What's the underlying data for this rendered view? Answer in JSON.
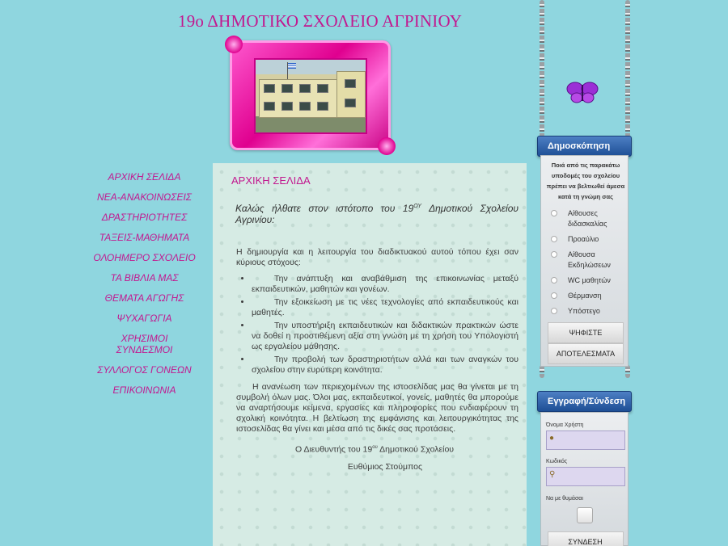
{
  "site": {
    "title": "19ο ΔΗΜΟΤΙΚΟ ΣΧΟΛΕΙΟ ΑΓΡΙΝΙΟΥ"
  },
  "nav": {
    "items": [
      "ΑΡΧΙΚΗ ΣΕΛΙΔΑ",
      "ΝΕΑ-ΑΝΑΚΟΙΝΩΣΕΙΣ",
      "ΔΡΑΣΤΗΡΙΟΤΗΤΕΣ",
      "ΤΑΞΕΙΣ-ΜΑΘΗΜΑΤΑ",
      "ΟΛΟΗΜΕΡΟ ΣΧΟΛΕΙΟ",
      "ΤΑ ΒΙΒΛΙΑ ΜΑΣ",
      "ΘΕΜΑΤΑ ΑΓΩΓΗΣ",
      "ΨΥΧΑΓΩΓΙΑ",
      "ΧΡΗΣΙΜΟΙ ΣΥΝΔΕΣΜΟΙ",
      "ΣΥΛΛΟΓΟΣ ΓΟΝΕΩΝ",
      "ΕΠΙΚΟΙΝΩΝΙΑ"
    ]
  },
  "content": {
    "heading": "ΑΡΧΙΚΗ ΣΕΛΙΔΑ",
    "welcome_pre": "Καλώς ήλθατε στον ιστότοπο του 19",
    "welcome_sup": "ΟΥ",
    "welcome_post": " Δημοτικού Σχολείου Αγρινίου:",
    "intro": "Η δημιουργία και η λειτουργία του διαδικτυακού αυτού τόπου έχει σαν κύριους στόχους:",
    "goals": [
      "Την ανάπτυξη και αναβάθμιση της επικοινωνίας μεταξύ εκπαιδευτικών, μαθητών και γονέων.",
      "Την εξοικείωση με τις νέες τεχνολογίες από εκπαιδευτικούς και μαθητές.",
      "Την υποστήριξη εκπαιδευτικών και διδακτικών πρακτικών ώστε να δοθεί η προστιθέμενη αξία στη γνώση με τη χρήση του Υπολογιστή ως εργαλείου μάθησης.",
      "Την προβολή των δραστηριοτήτων αλλά και των αναγκών του σχολείου στην ευρύτερη κοινότητα."
    ],
    "outro": "Η ανανέωση των περιεχομένων της ιστοσελίδας μας θα γίνεται με τη συμβολή όλων μας. Όλοι μας, εκπαιδευτικοί, γονείς, μαθητές θα μπορούμε να αναρτήσουμε κείμενα, εργασίες και πληροφορίες που ενδιαφέρουν τη σχολική κοινότητα. Η βελτίωση της εμφάνισης και λειτουργικότητας της ιστοσελίδας θα γίνει και μέσα από τις δικές σας προτάσεις.",
    "sign_pre": "Ο Διευθυντής του 19",
    "sign_sup": "ου",
    "sign_post": " Δημοτικού Σχολείου",
    "director": "Ευθύμιος Στούμπος"
  },
  "poll": {
    "title": "Δημοσκόπηση",
    "question": "Ποιά από τις παρακάτω υποδομές του σχολείου πρέπει να βελτιωθεί άμεσα κατά τη γνώμη σας",
    "options": [
      "Αίθουσες διδασκαλίας",
      "Προαύλιο",
      "Αίθουσα Εκδηλώσεων",
      "WC μαθητών",
      "Θέρμανση",
      "Υπόστεγο"
    ],
    "vote_label": "ΨΗΦΙΣΤΕ",
    "results_label": "ΑΠΟΤΕΛΕΣΜΑΤΑ"
  },
  "login": {
    "title": "Εγγραφή/Σύνδεση",
    "username_label": "Όνομα Χρήστη",
    "password_label": "Κωδικός",
    "remember_label": "Να με θυμάσαι",
    "submit_label": "ΣΥΝΔΕΣΗ"
  },
  "colors": {
    "background": "#8fd6df",
    "accent_magenta": "#c2188f",
    "panel_header_blue": "#1e4f95"
  }
}
